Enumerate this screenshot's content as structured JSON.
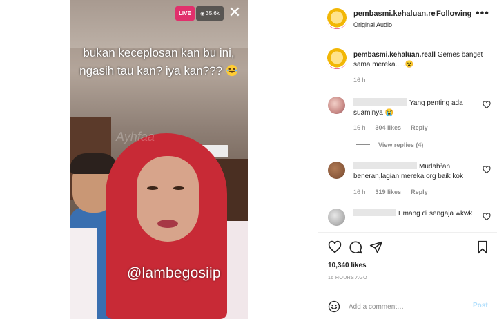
{
  "video": {
    "live_label": "LIVE",
    "viewers": "35.6k",
    "caption": "bukan keceplosan kan bu ini, ngasih tau kan? iya kan???",
    "watermark": "@lambegosiip",
    "faint_watermark": "Ayhfaa"
  },
  "header": {
    "username": "pembasmi.kehaluan.re",
    "separator": "•",
    "follow_status": "Following",
    "audio": "Original Audio",
    "more_label": "•••"
  },
  "post": {
    "username": "pembasmi.kehaluan.reall",
    "text": "Gemes banget sama mereka.....😮",
    "time": "16 h"
  },
  "comments": [
    {
      "text": "Yang penting ada suaminya 😭",
      "time": "16 h",
      "likes": "304 likes",
      "reply_label": "Reply",
      "avatar_color": "#c98a86"
    },
    {
      "text": "Mudah²an beneran,lagian mereka org baik kok",
      "time": "16 h",
      "likes": "319 likes",
      "reply_label": "Reply",
      "avatar_color": "#8b5a3c"
    },
    {
      "text": "Emang di sengaja wkwk",
      "avatar_color": "#a9a9a9"
    }
  ],
  "view_replies": "View replies (4)",
  "likes_count": "10,340 likes",
  "time_ago": "16 HOURS AGO",
  "comment_box": {
    "placeholder": "Add a comment…",
    "post_label": "Post"
  },
  "colors": {
    "live": "#e1306c",
    "post_button": "#b2dffc",
    "muted": "#8e8e8e"
  }
}
